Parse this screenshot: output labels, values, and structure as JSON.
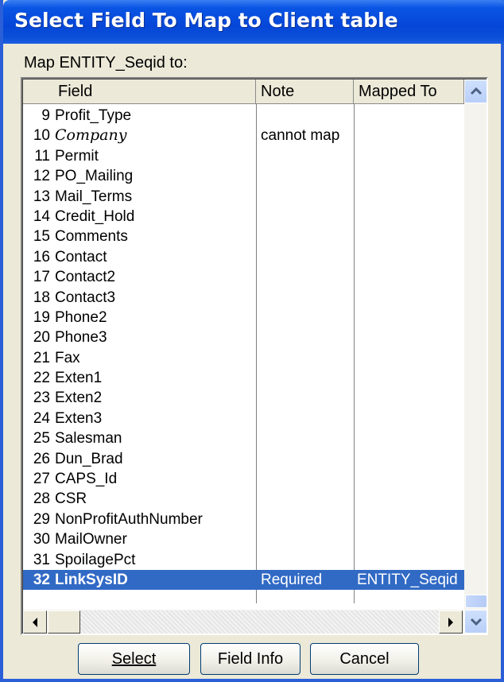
{
  "window": {
    "title": "Select Field To Map to Client table"
  },
  "prompt": "Map ENTITY_Seqid to:",
  "columns": {
    "field": "Field",
    "note": "Note",
    "mapped": "Mapped To"
  },
  "rows": [
    {
      "num": "9",
      "name": "Profit_Type",
      "note": "",
      "mapped": ""
    },
    {
      "num": "10",
      "name": "Company",
      "note": "cannot map",
      "mapped": "",
      "italic": true
    },
    {
      "num": "11",
      "name": "Permit",
      "note": "",
      "mapped": ""
    },
    {
      "num": "12",
      "name": "PO_Mailing",
      "note": "",
      "mapped": ""
    },
    {
      "num": "13",
      "name": "Mail_Terms",
      "note": "",
      "mapped": ""
    },
    {
      "num": "14",
      "name": "Credit_Hold",
      "note": "",
      "mapped": ""
    },
    {
      "num": "15",
      "name": "Comments",
      "note": "",
      "mapped": ""
    },
    {
      "num": "16",
      "name": "Contact",
      "note": "",
      "mapped": ""
    },
    {
      "num": "17",
      "name": "Contact2",
      "note": "",
      "mapped": ""
    },
    {
      "num": "18",
      "name": "Contact3",
      "note": "",
      "mapped": ""
    },
    {
      "num": "19",
      "name": "Phone2",
      "note": "",
      "mapped": ""
    },
    {
      "num": "20",
      "name": "Phone3",
      "note": "",
      "mapped": ""
    },
    {
      "num": "21",
      "name": "Fax",
      "note": "",
      "mapped": ""
    },
    {
      "num": "22",
      "name": "Exten1",
      "note": "",
      "mapped": ""
    },
    {
      "num": "23",
      "name": "Exten2",
      "note": "",
      "mapped": ""
    },
    {
      "num": "24",
      "name": "Exten3",
      "note": "",
      "mapped": ""
    },
    {
      "num": "25",
      "name": "Salesman",
      "note": "",
      "mapped": ""
    },
    {
      "num": "26",
      "name": "Dun_Brad",
      "note": "",
      "mapped": ""
    },
    {
      "num": "27",
      "name": "CAPS_Id",
      "note": "",
      "mapped": ""
    },
    {
      "num": "28",
      "name": "CSR",
      "note": "",
      "mapped": ""
    },
    {
      "num": "29",
      "name": "NonProfitAuthNumber",
      "note": "",
      "mapped": ""
    },
    {
      "num": "30",
      "name": "MailOwner",
      "note": "",
      "mapped": ""
    },
    {
      "num": "31",
      "name": "SpoilagePct",
      "note": "",
      "mapped": ""
    },
    {
      "num": "32",
      "name": "LinkSysID",
      "note": "Required",
      "mapped": "ENTITY_Seqid",
      "selected": true
    }
  ],
  "buttons": {
    "select": "Select",
    "field_info": "Field Info",
    "cancel": "Cancel"
  },
  "colors": {
    "title_bar": "#0546d8",
    "selection": "#316ac5",
    "dialog_bg": "#ece9d8"
  },
  "icons": {
    "scroll_up": "chevron-up-icon",
    "scroll_down": "chevron-down-icon",
    "scroll_left": "arrow-left-icon",
    "scroll_right": "arrow-right-icon"
  }
}
